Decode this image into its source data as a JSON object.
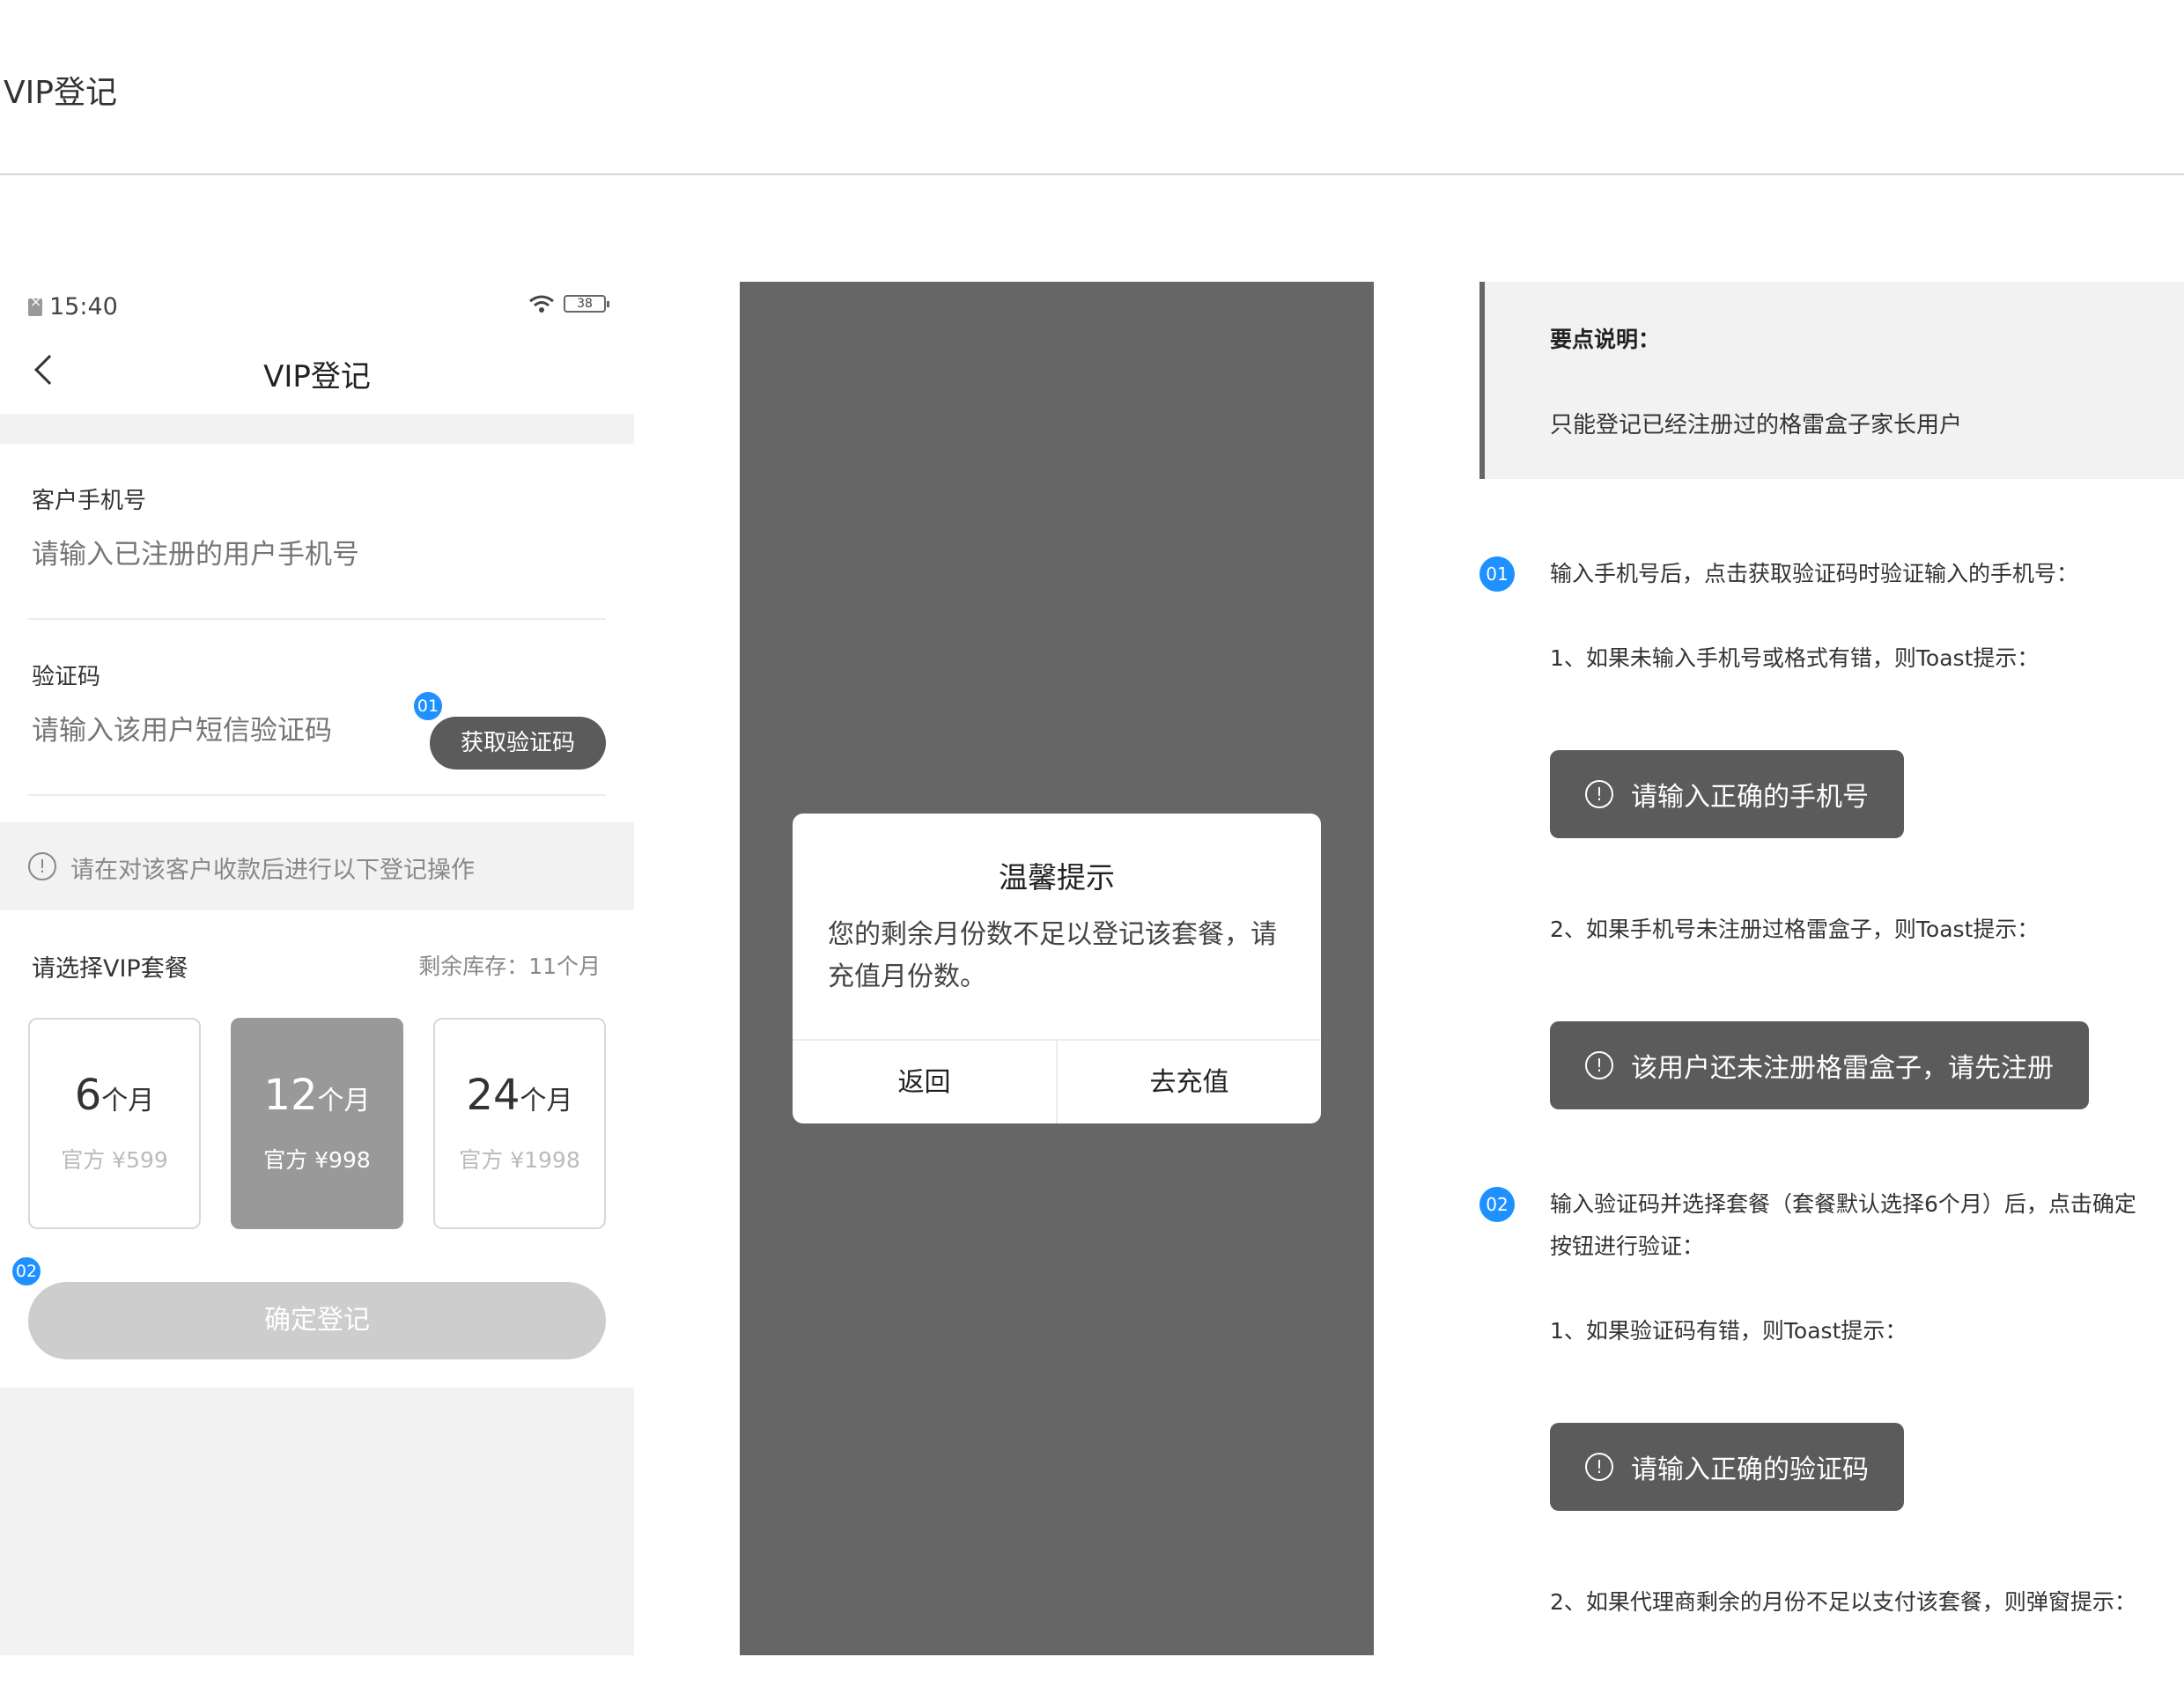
{
  "page": {
    "title": "VIP登记"
  },
  "phone": {
    "status": {
      "time": "15:40",
      "battery": "38"
    },
    "nav_title": "VIP登记",
    "phone_label": "客户手机号",
    "phone_placeholder": "请输入已注册的用户手机号",
    "code_label": "验证码",
    "code_placeholder": "请输入该用户短信验证码",
    "code_button": "获取验证码",
    "notice": "请在对该客户收款后进行以下登记操作",
    "plan_label": "请选择VIP套餐",
    "stock": "剩余库存：11个月",
    "plans": [
      {
        "months": "6",
        "unit": "个月",
        "price": "官方 ¥599",
        "selected": false
      },
      {
        "months": "12",
        "unit": "个月",
        "price": "官方 ¥998",
        "selected": true
      },
      {
        "months": "24",
        "unit": "个月",
        "price": "官方 ¥1998",
        "selected": false
      }
    ],
    "confirm_button": "确定登记",
    "badge1": "01",
    "badge2": "02"
  },
  "dialog": {
    "title": "温馨提示",
    "body": "您的剩余月份数不足以登记该套餐，请充值月份数。",
    "cancel": "返回",
    "ok": "去充值"
  },
  "notes": {
    "title": "要点说明：",
    "text": "只能登记已经注册过的格雷盒子家长用户",
    "step1_badge": "01",
    "step1": "输入手机号后，点击获取验证码时验证输入的手机号：",
    "step1_a": "1、如果未输入手机号或格式有错，则Toast提示：",
    "toast1": "请输入正确的手机号",
    "step1_b": "2、如果手机号未注册过格雷盒子，则Toast提示：",
    "toast2": "该用户还未注册格雷盒子，请先注册",
    "step2_badge": "02",
    "step2_line1": "输入验证码并选择套餐（套餐默认选择6个月）后，点击确定",
    "step2_line2": "按钮进行验证：",
    "step2_a": "1、如果验证码有错，则Toast提示：",
    "toast3": "请输入正确的验证码",
    "step2_b": "2、如果代理商剩余的月份不足以支付该套餐，则弹窗提示："
  }
}
